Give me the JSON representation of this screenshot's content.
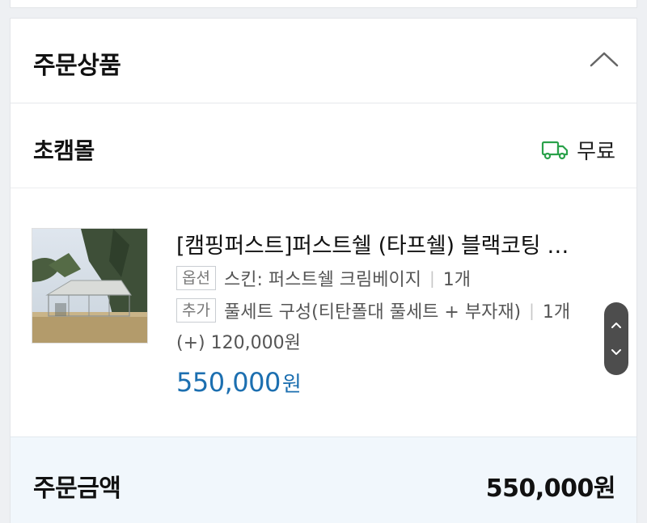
{
  "section": {
    "title": "주문상품",
    "toggle_icon": "chevron-up-icon"
  },
  "seller": {
    "name": "초캠몰",
    "shipping_label": "무료",
    "shipping_icon": "delivery-truck-icon",
    "shipping_color": "#2aa14a"
  },
  "item": {
    "title": "[캠핑퍼스트]퍼스트쉘 (타프쉘) 블랙코팅 …",
    "options": [
      {
        "badge": "옵션",
        "text": "스킨: 퍼스트쉘 크림베이지",
        "qty": "1개"
      },
      {
        "badge": "추가",
        "text": "풀세트 구성(티탄폴대 풀세트 + 부자재)",
        "qty": "1개"
      }
    ],
    "addon_price": "(+) 120,000원",
    "price_number": "550,000",
    "price_unit": "원",
    "price_color": "#1c6fb0"
  },
  "summary": {
    "label": "주문금액",
    "value": "550,000원"
  }
}
